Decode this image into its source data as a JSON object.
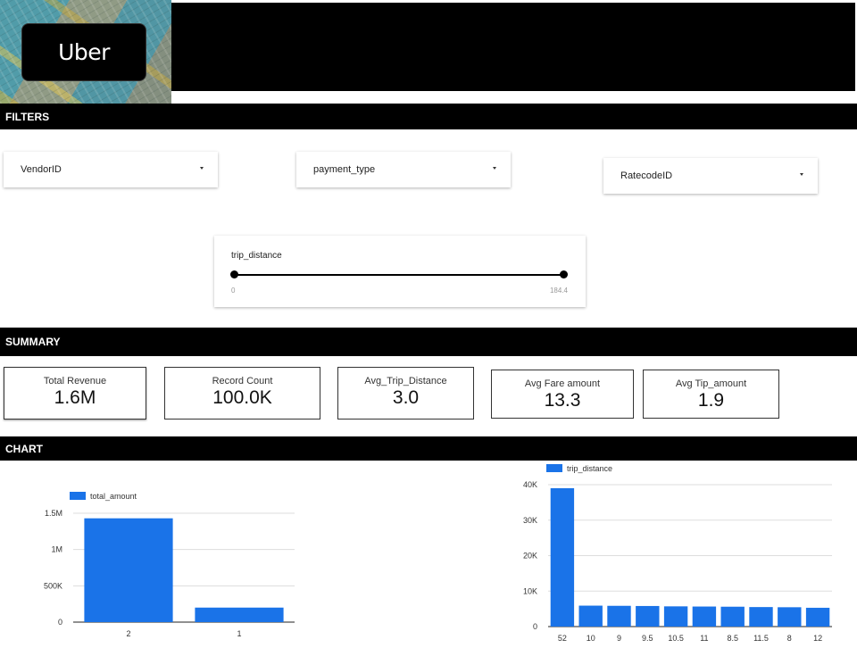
{
  "header": {
    "logo_text": "Uber"
  },
  "filters": {
    "title": "FILTERS",
    "dropdowns": [
      {
        "label": "VendorID"
      },
      {
        "label": "payment_type"
      },
      {
        "label": "RatecodeID"
      }
    ],
    "slider": {
      "label": "trip_distance",
      "min_label": "0",
      "max_label": "184.4",
      "min": 0,
      "max": 184.4
    }
  },
  "summary": {
    "title": "SUMMARY",
    "kpis": [
      {
        "label": "Total Revenue",
        "value": "1.6M"
      },
      {
        "label": "Record Count",
        "value": "100.0K"
      },
      {
        "label": "Avg_Trip_Distance",
        "value": "3.0"
      },
      {
        "label": "Avg Fare amount",
        "value": "13.3"
      },
      {
        "label": "Avg Tip_amount",
        "value": "1.9"
      }
    ]
  },
  "chart_section": {
    "title": "CHART"
  },
  "colors": {
    "bar": "#1a73e8",
    "header": "#000000"
  },
  "chart_data": [
    {
      "type": "bar",
      "categories": [
        "2",
        "1"
      ],
      "series": [
        {
          "name": "total_amount",
          "values": [
            1430000,
            200000
          ]
        }
      ],
      "ylim": [
        0,
        1500000
      ],
      "y_ticks": [
        "0",
        "500K",
        "1M",
        "1.5M"
      ],
      "y_tick_values": [
        0,
        500000,
        1000000,
        1500000
      ],
      "legend": "top-left",
      "grid": true
    },
    {
      "type": "bar",
      "categories": [
        "52",
        "10",
        "9",
        "9.5",
        "10.5",
        "11",
        "8.5",
        "11.5",
        "8",
        "12"
      ],
      "series": [
        {
          "name": "trip_distance",
          "values": [
            39000,
            5900,
            5850,
            5800,
            5700,
            5650,
            5600,
            5500,
            5450,
            5300
          ]
        }
      ],
      "ylim": [
        0,
        40000
      ],
      "y_ticks": [
        "0",
        "10K",
        "20K",
        "30K",
        "40K"
      ],
      "y_tick_values": [
        0,
        10000,
        20000,
        30000,
        40000
      ],
      "legend": "top-left",
      "grid": true
    }
  ]
}
